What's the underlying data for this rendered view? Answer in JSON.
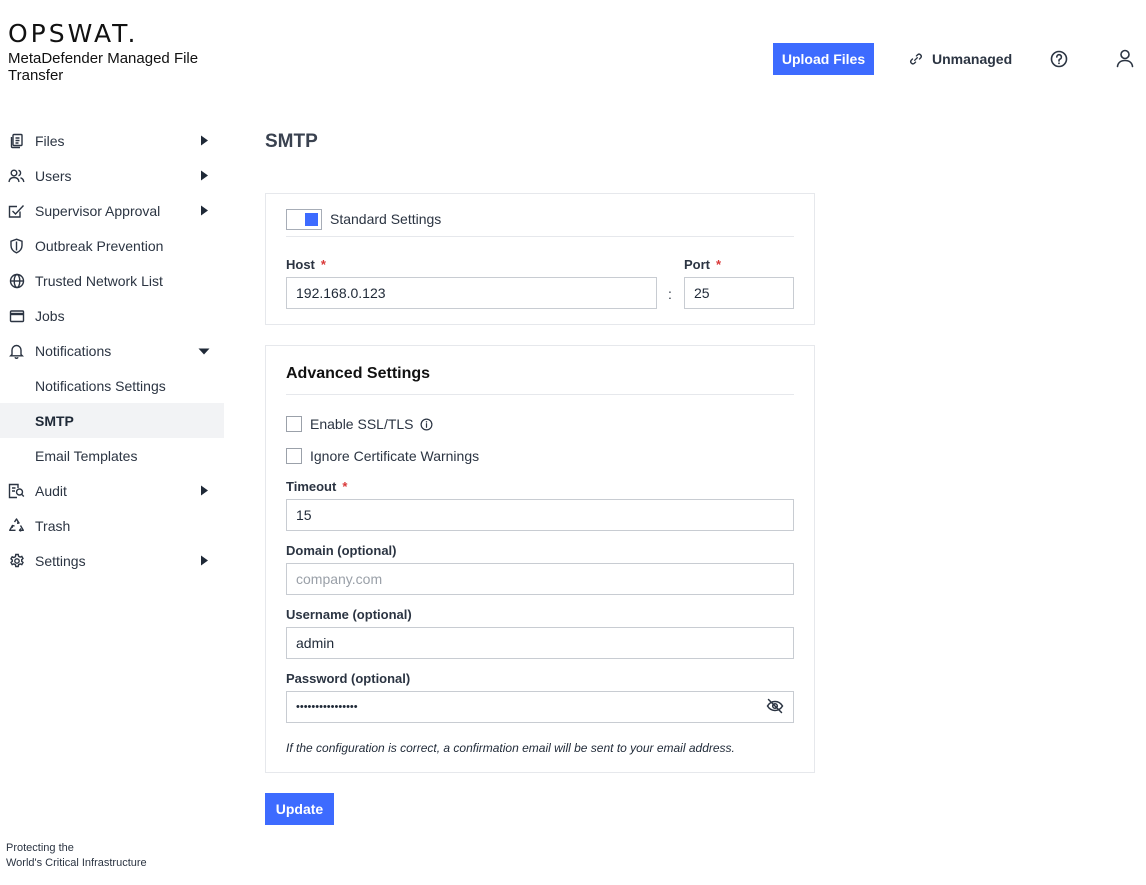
{
  "brand": {
    "logo": "OPSWAT.",
    "product_name": "MetaDefender Managed File Transfer",
    "tagline_line1": "Protecting the",
    "tagline_line2": "World's Critical Infrastructure"
  },
  "header": {
    "upload_label": "Upload Files",
    "unmanaged_label": "Unmanaged",
    "accent_color": "#3d6bff"
  },
  "sidebar": {
    "items": [
      {
        "label": "Files",
        "icon": "files-icon",
        "caret": "right"
      },
      {
        "label": "Users",
        "icon": "users-icon",
        "caret": "right"
      },
      {
        "label": "Supervisor Approval",
        "icon": "approval-icon",
        "caret": "right"
      },
      {
        "label": "Outbreak Prevention",
        "icon": "shield-icon"
      },
      {
        "label": "Trusted Network List",
        "icon": "globe-icon"
      },
      {
        "label": "Jobs",
        "icon": "jobs-icon"
      },
      {
        "label": "Notifications",
        "icon": "bell-icon",
        "caret": "down"
      },
      {
        "label": "Notifications Settings",
        "sub": true
      },
      {
        "label": "SMTP",
        "sub": true,
        "active": true
      },
      {
        "label": "Email Templates",
        "sub": true
      },
      {
        "label": "Audit",
        "icon": "audit-icon",
        "caret": "right"
      },
      {
        "label": "Trash",
        "icon": "recycle-icon"
      },
      {
        "label": "Settings",
        "icon": "gear-icon",
        "caret": "right"
      }
    ]
  },
  "main": {
    "title": "SMTP",
    "standard": {
      "toggle_label": "Standard Settings",
      "toggle_on": true,
      "host_label": "Host",
      "host_value": "192.168.0.123",
      "port_label": "Port",
      "port_value": "25",
      "required_mark": "*",
      "separator": ":"
    },
    "advanced": {
      "heading": "Advanced Settings",
      "ssl_label": "Enable SSL/TLS",
      "ssl_checked": false,
      "ignore_cert_label": "Ignore Certificate Warnings",
      "ignore_cert_checked": false,
      "timeout_label": "Timeout",
      "timeout_value": "15",
      "domain_label": "Domain (optional)",
      "domain_value": "",
      "domain_placeholder": "company.com",
      "username_label": "Username (optional)",
      "username_value": "admin",
      "password_label": "Password (optional)",
      "password_value": "••••••••••••••••",
      "hint": "If the configuration is correct, a confirmation email will be sent to your email address."
    },
    "update_label": "Update"
  }
}
